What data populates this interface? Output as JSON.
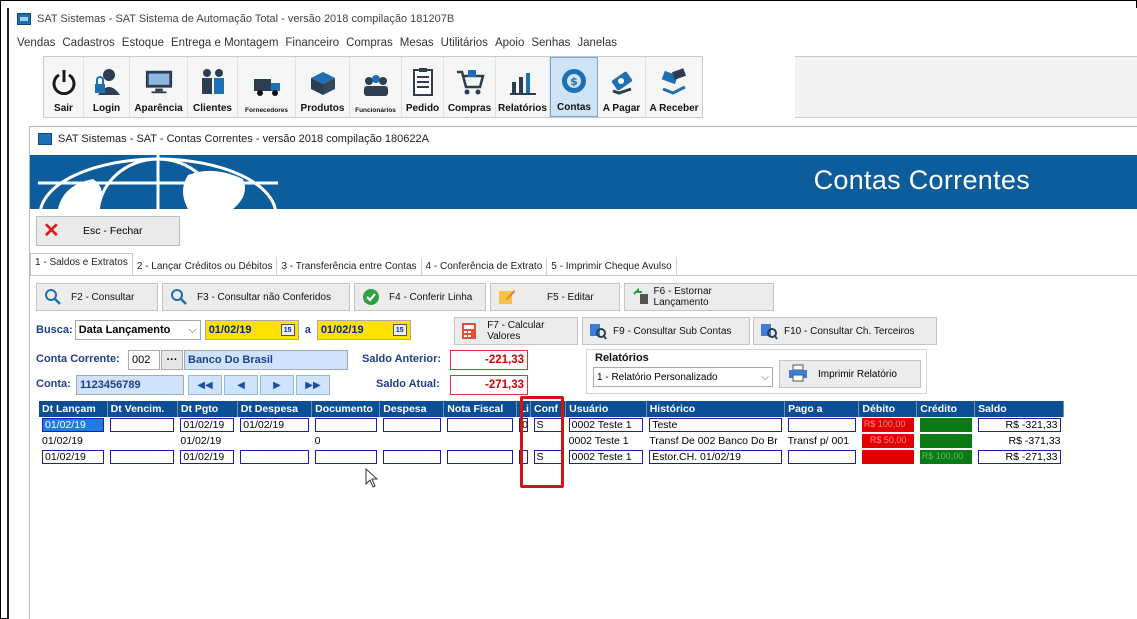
{
  "window": {
    "title": "SAT Sistemas - SAT Sistema de Automação Total - versão 2018 compilação 181207B"
  },
  "menu": [
    "Vendas",
    "Cadastros",
    "Estoque",
    "Entrega e Montagem",
    "Financeiro",
    "Compras",
    "Mesas",
    "Utilitários",
    "Apoio",
    "Senhas",
    "Janelas"
  ],
  "toolbar": [
    {
      "label": "Sair",
      "icon": "power-icon"
    },
    {
      "label": "Login",
      "icon": "user-lock-icon"
    },
    {
      "label": "Aparência",
      "icon": "monitor-icon"
    },
    {
      "label": "Clientes",
      "icon": "people-icon"
    },
    {
      "label": "Fornecedores",
      "icon": "truck-icon"
    },
    {
      "label": "Produtos",
      "icon": "boxes-icon"
    },
    {
      "label": "Funcionários",
      "icon": "group-icon"
    },
    {
      "label": "Pedido",
      "icon": "clipboard-icon"
    },
    {
      "label": "Compras",
      "icon": "cart-icon"
    },
    {
      "label": "Relatórios",
      "icon": "bar-chart-icon"
    },
    {
      "label": "Contas",
      "icon": "money-icon"
    },
    {
      "label": "A Pagar",
      "icon": "pay-icon"
    },
    {
      "label": "A Receber",
      "icon": "receive-icon"
    }
  ],
  "child": {
    "title": "SAT Sistemas - SAT - Contas Correntes - versão 2018 compilação 180622A",
    "banner_title": "Contas Correntes",
    "close_label": "Esc - Fechar",
    "tabs": [
      "1 - Saldos e Extratos",
      "2 - Lançar Créditos ou Débitos",
      "3 - Transferência entre Contas",
      "4 - Conferência de Extrato",
      "5 - Imprimir Cheque Avulso"
    ],
    "actions": {
      "consultar": "F2 - Consultar",
      "nao_conferidos": "F3 - Consultar não Conferidos",
      "conferir": "F4 - Conferir Linha",
      "editar": "F5 - Editar",
      "estornar": "F6 - Estornar Lançamento",
      "calcular": "F7 - Calcular Valores",
      "sub_contas": "F9 - Consultar Sub Contas",
      "terceiros": "F10 - Consultar Ch. Terceiros"
    },
    "filter": {
      "busca_label": "Busca:",
      "busca_value": "Data Lançamento",
      "date_from": "01/02/19",
      "date_sep": "a",
      "date_to": "01/02/19",
      "conta_corrente_label": "Conta Corrente:",
      "conta_corrente_code": "002",
      "ellipsis": "···",
      "bank": "Banco Do Brasil",
      "conta_label": "Conta:",
      "conta_value": "1123456789",
      "saldo_anterior_label": "Saldo Anterior:",
      "saldo_anterior": "-221,33",
      "saldo_atual_label": "Saldo Atual:",
      "saldo_atual": "-271,33"
    },
    "relatorios": {
      "label": "Relatórios",
      "selected": "1 - Relatório Personalizado",
      "print_label": "Imprimir Relatório"
    },
    "grid": {
      "columns": [
        "Dt Lançam",
        "Dt Vencim.",
        "Dt Pgto",
        "Dt Despesa",
        "Documento",
        "Despesa",
        "Nota Fiscal",
        "Li",
        "Conf",
        "Usuário",
        "Histórico",
        "Pago a",
        "Débito",
        "Crédito",
        "Saldo"
      ],
      "rows": [
        {
          "dt_lanc": "01/02/19",
          "dt_venc": "",
          "dt_pgto": "01/02/19",
          "dt_desp": "01/02/19",
          "documento": "",
          "despesa": "",
          "nota": "",
          "li": "01",
          "conf": "S",
          "usuario": "0002 Teste 1",
          "historico": "Teste",
          "pago_a": "",
          "debito": "R$ 100,00",
          "credito": "",
          "saldo": "R$ -321,33"
        },
        {
          "dt_lanc": "01/02/19",
          "dt_venc": "",
          "dt_pgto": "01/02/19",
          "dt_desp": "",
          "documento": "0",
          "despesa": "",
          "nota": "",
          "li": "",
          "conf": "",
          "usuario": "0002 Teste 1",
          "historico": "Transf De 002 Banco Do Br",
          "pago_a": "Transf p/ 001",
          "debito": "R$ 50,00",
          "credito": "",
          "saldo": "R$ -371,33"
        },
        {
          "dt_lanc": "01/02/19",
          "dt_venc": "",
          "dt_pgto": "01/02/19",
          "dt_desp": "",
          "documento": "",
          "despesa": "",
          "nota": "",
          "li": "",
          "conf": "S",
          "usuario": "0002 Teste 1",
          "historico": "Estor.CH. 01/02/19",
          "pago_a": "",
          "debito": "",
          "credito": "R$ 100,00",
          "saldo": "R$ -271,33"
        }
      ]
    }
  }
}
